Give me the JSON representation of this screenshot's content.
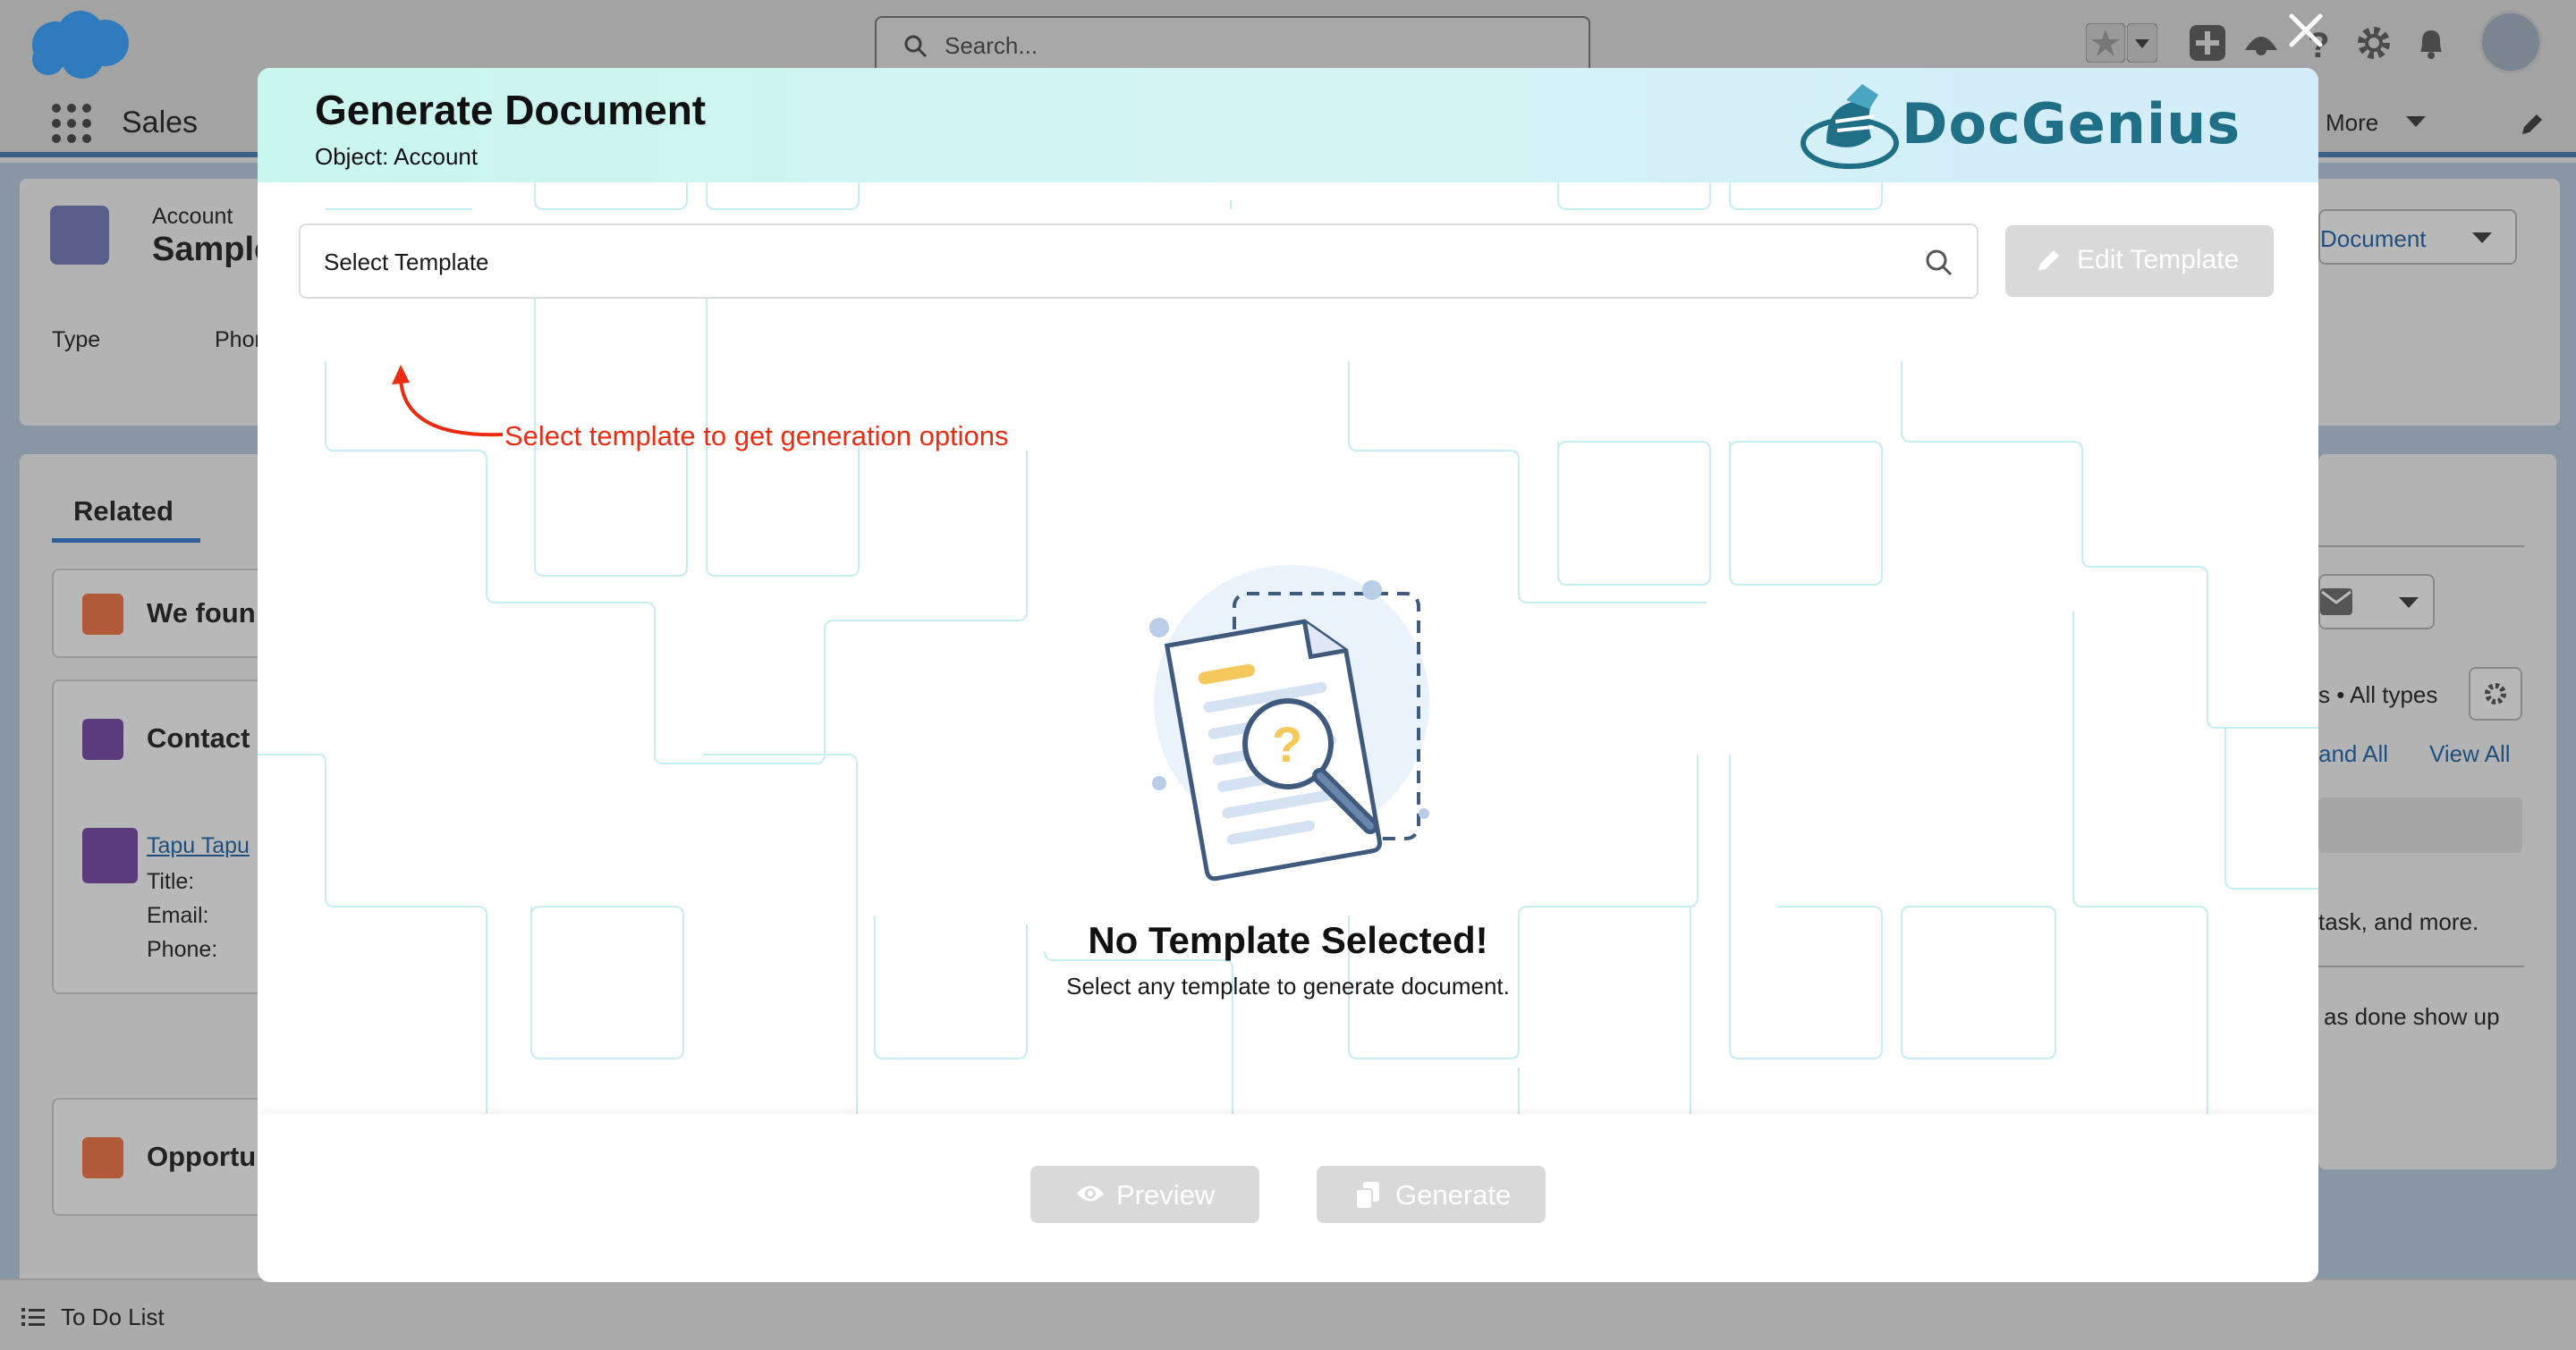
{
  "global": {
    "search_placeholder": "Search...",
    "icons": [
      "salesforce-cloud-icon",
      "search-icon",
      "favorites-star-icon",
      "favorites-dropdown-icon",
      "add-icon",
      "trailhead-icon",
      "help-icon",
      "setup-gear-icon",
      "notifications-bell-icon",
      "user-avatar-icon"
    ]
  },
  "nav": {
    "app_name": "Sales",
    "more_label": "More"
  },
  "record": {
    "object_label": "Account",
    "name_partial": "Sample",
    "field_type_label": "Type",
    "field_phone_label": "Phor",
    "action_document_label": "Document"
  },
  "related": {
    "tab_label": "Related",
    "we_found_label": "We foun",
    "contacts_label": "Contact",
    "contact_name": "Tapu Tapu",
    "contact_title_label": "Title:",
    "contact_email_label": "Email:",
    "contact_phone_label": "Phone:",
    "opportunities_label": "Opportu"
  },
  "activity": {
    "filter_text": "s • All types",
    "expand_all": "and All",
    "view_all": "View All",
    "task_text": "task, and more.",
    "done_text": "as done show up"
  },
  "utility_bar": {
    "todo_label": "To Do List"
  },
  "modal": {
    "title": "Generate Document",
    "object_line": "Object: Account",
    "logo_text": "DocGenius",
    "template_placeholder": "Select Template",
    "edit_template_label": "Edit Template",
    "hint_text": "Select template to get generation options",
    "empty_title": "No Template Selected!",
    "empty_subtitle": "Select any template to generate document.",
    "preview_label": "Preview",
    "generate_label": "Generate",
    "colors": {
      "header_gradient_start": "#c9f6ee",
      "header_gradient_end": "#d3ecfa",
      "logo": "#1f6f86",
      "hint_red": "#ea2d12",
      "disabled_button": "#d9d9d9"
    }
  }
}
